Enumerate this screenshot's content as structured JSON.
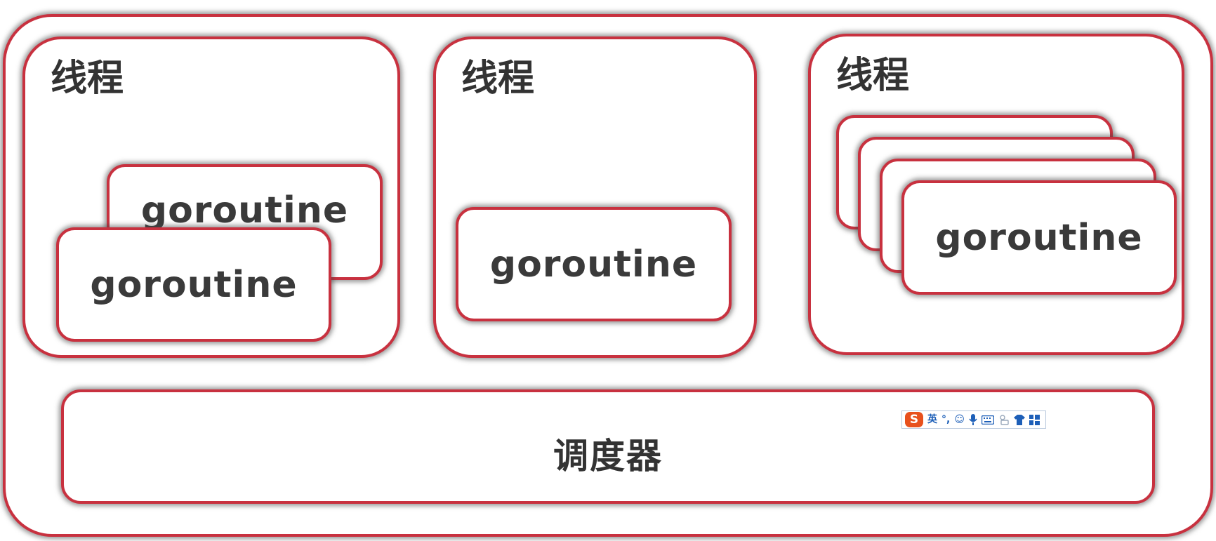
{
  "threads": [
    {
      "label": "线程",
      "goroutines": [
        "goroutine",
        "goroutine"
      ]
    },
    {
      "label": "线程",
      "goroutines": [
        "goroutine"
      ]
    },
    {
      "label": "线程",
      "goroutines": [
        "goroutine"
      ]
    }
  ],
  "scheduler": {
    "label": "调度器"
  },
  "ime_toolbar": {
    "logo": "S",
    "mode": "英",
    "icons": [
      "punctuation-icon",
      "emoji-icon",
      "microphone-icon",
      "keyboard-icon",
      "handwriting-icon",
      "skin-shirt-icon",
      "toolbox-grid-icon"
    ],
    "accent": "#e8511d",
    "icon_color": "#1d5fb8"
  },
  "colors": {
    "border": "#c8313f",
    "text": "#333333"
  }
}
